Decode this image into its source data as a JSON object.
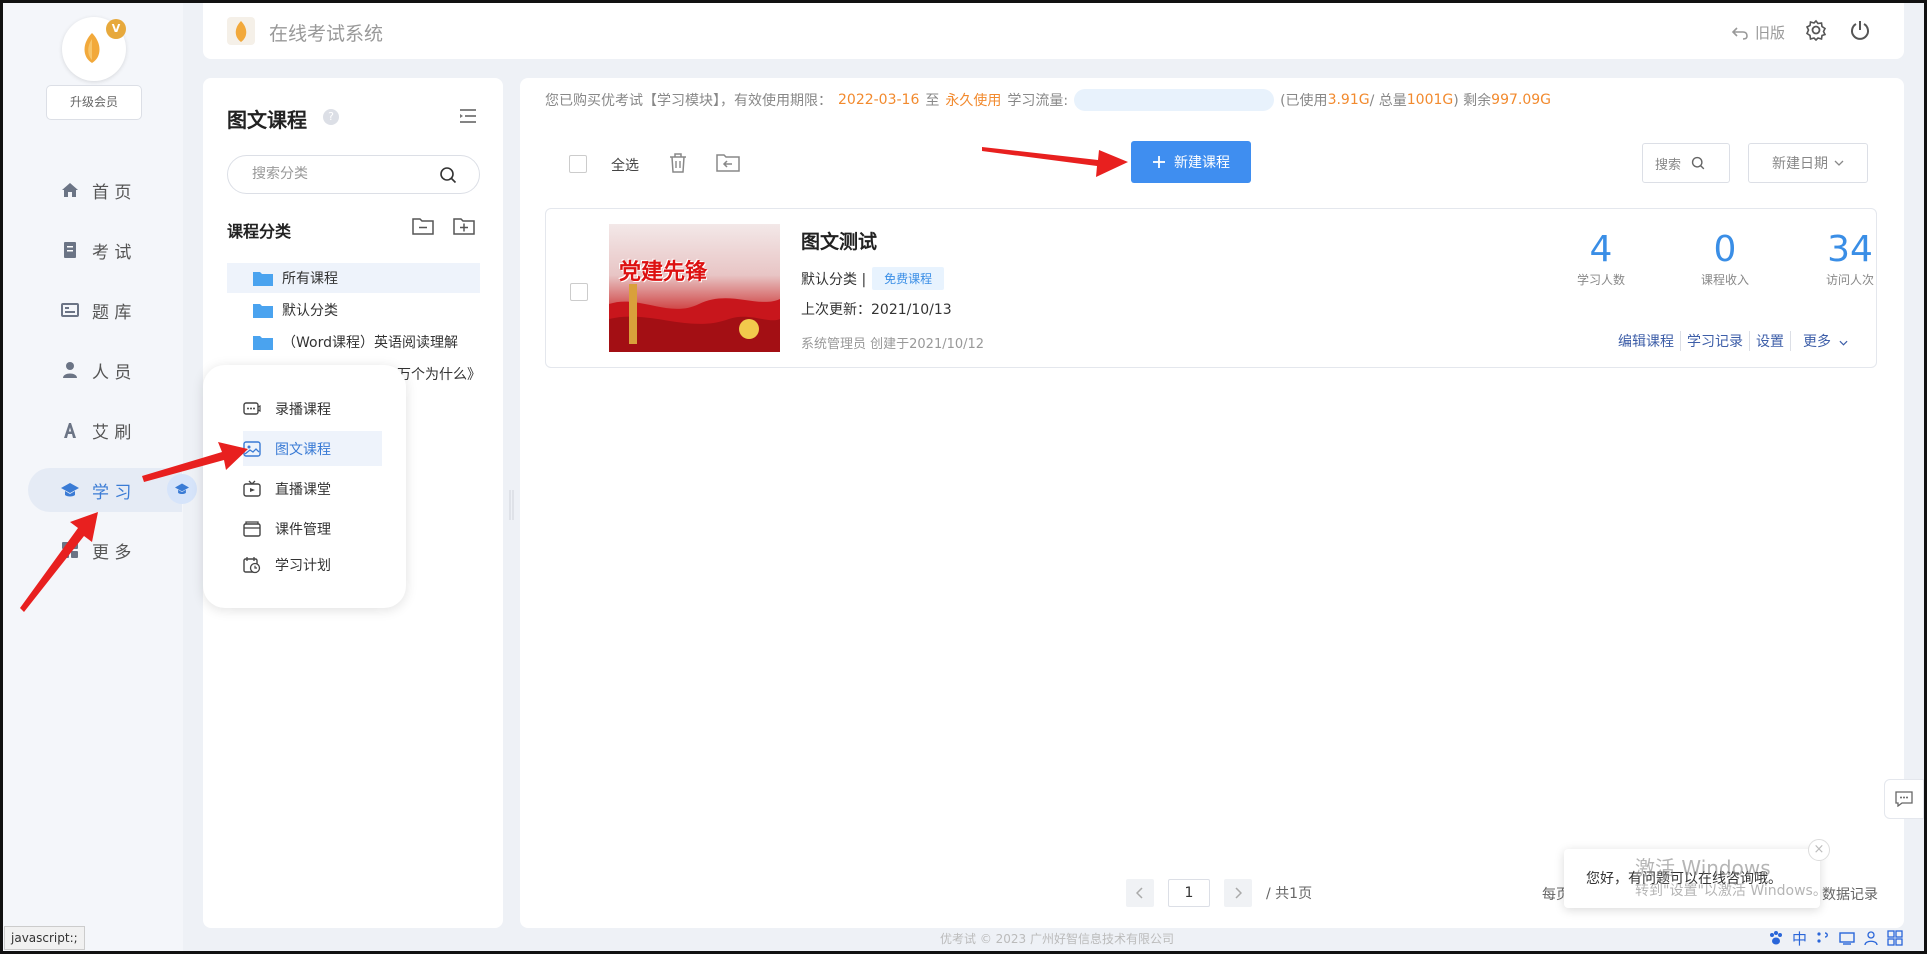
{
  "app": {
    "title": "在线考试系统",
    "old_version": "旧版",
    "footer": "优考试 © 2023 广州好智信息技术有限公司",
    "status_url": "javascript:;"
  },
  "leftnav": {
    "crown_badge": "V",
    "upgrade_label": "升级会员",
    "items": [
      {
        "label": "首 页",
        "icon": "home-icon"
      },
      {
        "label": "考 试",
        "icon": "exam-icon"
      },
      {
        "label": "题 库",
        "icon": "question-bank-icon"
      },
      {
        "label": "人 员",
        "icon": "person-icon"
      },
      {
        "label": "艾 刷",
        "icon": "font-a-icon"
      },
      {
        "label": "学 习",
        "icon": "graduation-cap-icon"
      },
      {
        "label": "更 多",
        "icon": "more-icon"
      }
    ]
  },
  "category_panel": {
    "title": "图文课程",
    "help": "?",
    "search_placeholder": "搜索分类",
    "section_title": "课程分类",
    "tree": [
      "所有课程",
      "默认分类",
      "（Word课程）英语阅读理解",
      "万个为什么》"
    ]
  },
  "popup_menu": {
    "items": [
      {
        "label": "录播课程",
        "icon": "recorded-video-icon"
      },
      {
        "label": "图文课程",
        "icon": "image-text-icon"
      },
      {
        "label": "直播课堂",
        "icon": "live-tv-icon"
      },
      {
        "label": "课件管理",
        "icon": "courseware-icon"
      },
      {
        "label": "学习计划",
        "icon": "study-plan-icon"
      }
    ]
  },
  "notice": {
    "prefix": "您已购买优考试【学习模块】，有效使用期限：",
    "start": "2022-03-16",
    "to": "至",
    "end": "永久使用",
    "traffic_label": "学习流量:",
    "used_prefix": "(已使用",
    "used": "3.91G",
    "total_sep": " / 总量",
    "total": "1001G",
    "remain_prefix": ") 剩余",
    "remain": "997.09G"
  },
  "toolbar": {
    "select_all": "全选",
    "new_course": "新建课程",
    "search": "搜索",
    "sort": "新建日期"
  },
  "course": {
    "thumb_text": "党建先锋",
    "title": "图文测试",
    "category": "默认分类 |",
    "tag": "免费课程",
    "updated": "上次更新：2021/10/13",
    "creator": "系统管理员 创建于2021/10/12",
    "stats": [
      {
        "value": "4",
        "label": "学习人数"
      },
      {
        "value": "0",
        "label": "课程收入"
      },
      {
        "value": "34",
        "label": "访问人次"
      }
    ],
    "actions": [
      "编辑课程",
      "学习记录",
      "设置",
      "更多"
    ]
  },
  "pager": {
    "page": "1",
    "total": "/ 共1页",
    "per_page": "每页",
    "data_record": "数据记录"
  },
  "chat": {
    "message": "您好，有问题可以在线咨询哦。",
    "close": "×"
  },
  "watermark": {
    "line1": "激活 Windows",
    "line2": "转到\"设置\"以激活 Windows。"
  },
  "tray": {
    "ime": "中"
  },
  "colors": {
    "primary": "#3f8ef0",
    "accent_orange": "#f28a2e",
    "arrow_red": "#e8201f"
  }
}
